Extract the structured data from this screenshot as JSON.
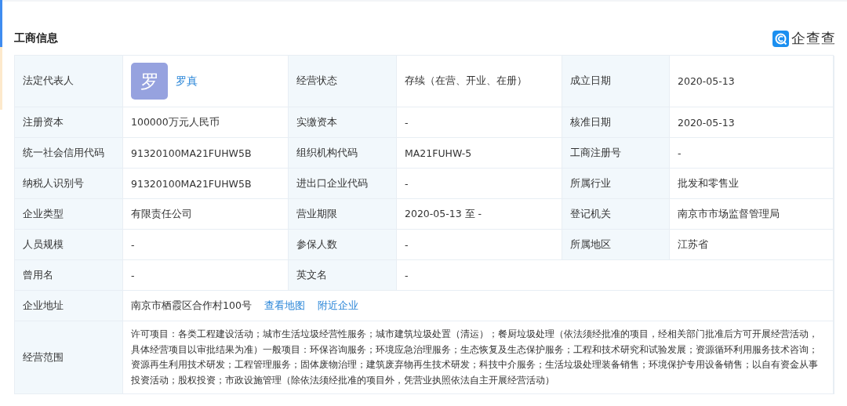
{
  "section_title": "工商信息",
  "logo": {
    "text": "企查查"
  },
  "rows": [
    {
      "fields": [
        {
          "label": "法定代表人",
          "kind": "person",
          "avatar": "罗",
          "value": "罗真"
        },
        {
          "label": "经营状态",
          "kind": "text",
          "value": "存续（在营、开业、在册）"
        },
        {
          "label": "成立日期",
          "kind": "text",
          "value": "2020-05-13"
        }
      ]
    },
    {
      "fields": [
        {
          "label": "注册资本",
          "kind": "text",
          "value": "100000万元人民币"
        },
        {
          "label": "实缴资本",
          "kind": "text",
          "value": "-"
        },
        {
          "label": "核准日期",
          "kind": "text",
          "value": "2020-05-13"
        }
      ]
    },
    {
      "fields": [
        {
          "label": "统一社会信用代码",
          "kind": "text",
          "value": "91320100MA21FUHW5B"
        },
        {
          "label": "组织机构代码",
          "kind": "text",
          "value": "MA21FUHW-5"
        },
        {
          "label": "工商注册号",
          "kind": "text",
          "value": "-"
        }
      ]
    },
    {
      "fields": [
        {
          "label": "纳税人识别号",
          "kind": "text",
          "value": "91320100MA21FUHW5B"
        },
        {
          "label": "进出口企业代码",
          "kind": "text",
          "value": "-"
        },
        {
          "label": "所属行业",
          "kind": "text",
          "value": "批发和零售业"
        }
      ]
    },
    {
      "fields": [
        {
          "label": "企业类型",
          "kind": "text",
          "value": "有限责任公司"
        },
        {
          "label": "营业期限",
          "kind": "text",
          "value": "2020-05-13 至 -"
        },
        {
          "label": "登记机关",
          "kind": "text",
          "value": "南京市市场监督管理局"
        }
      ]
    },
    {
      "fields": [
        {
          "label": "人员规模",
          "kind": "text",
          "value": "-"
        },
        {
          "label": "参保人数",
          "kind": "text",
          "value": "-"
        },
        {
          "label": "所属地区",
          "kind": "text",
          "value": "江苏省"
        }
      ]
    },
    {
      "fields": [
        {
          "label": "曾用名",
          "kind": "text",
          "value": "-"
        },
        {
          "label": "英文名",
          "kind": "text",
          "value": "-"
        }
      ]
    },
    {
      "fields": [
        {
          "label": "企业地址",
          "kind": "address",
          "value": "南京市栖霞区合作村100号",
          "links": [
            "查看地图",
            "附近企业"
          ]
        }
      ]
    },
    {
      "fields": [
        {
          "label": "经营范围",
          "kind": "paragraph",
          "value": "许可项目：各类工程建设活动；城市生活垃圾经营性服务；城市建筑垃圾处置（清运）；餐厨垃圾处理（依法须经批准的项目，经相关部门批准后方可开展经营活动，具体经营项目以审批结果为准）一般项目：环保咨询服务；环境应急治理服务；生态恢复及生态保护服务；工程和技术研究和试验发展；资源循环利用服务技术咨询；资源再生利用技术研发；工程管理服务；固体废物治理；建筑废弃物再生技术研发；科技中介服务；生活垃圾处理装备销售；环境保护专用设备销售；以自有资金从事投资活动；股权投资；市政设施管理（除依法须经批准的项目外，凭营业执照依法自主开展经营活动）"
        }
      ]
    }
  ]
}
